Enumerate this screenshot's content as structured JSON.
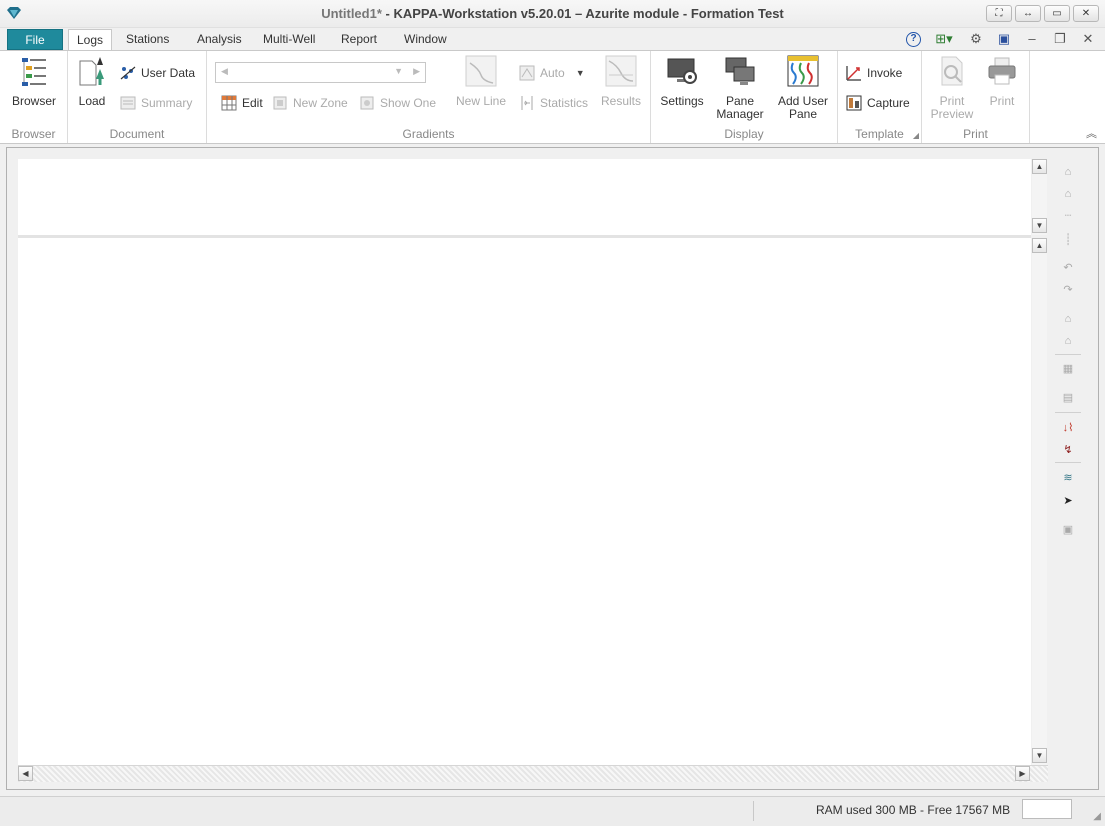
{
  "titlebar": {
    "doc_name": "Untitled1*",
    "title_rest": " - KAPPA-Workstation v5.20.01  – Azurite module - Formation Test"
  },
  "tabs": {
    "file": "File",
    "logs": "Logs",
    "stations": "Stations",
    "analysis": "Analysis",
    "multiwell": "Multi-Well",
    "report": "Report",
    "window": "Window"
  },
  "ribbon": {
    "browser": {
      "button": "Browser",
      "group": "Browser"
    },
    "document": {
      "load": "Load",
      "user_data": "User Data",
      "summary": "Summary",
      "group": "Document"
    },
    "gradients": {
      "edit": "Edit",
      "new_zone": "New Zone",
      "show_one": "Show One",
      "new_line": "New Line",
      "auto": "Auto",
      "statistics": "Statistics",
      "results": "Results",
      "group": "Gradients"
    },
    "display": {
      "settings": "Settings",
      "pane_manager_1": "Pane",
      "pane_manager_2": "Manager",
      "add_user_pane_1": "Add User",
      "add_user_pane_2": "Pane",
      "group": "Display"
    },
    "template": {
      "invoke": "Invoke",
      "capture": "Capture",
      "group": "Template"
    },
    "print": {
      "print_preview_1": "Print",
      "print_preview_2": "Preview",
      "print": "Print",
      "group": "Print"
    }
  },
  "status": {
    "ram": "RAM used 300 MB - Free 17567 MB"
  },
  "colors": {
    "file_tab": "#1f8a9c",
    "accent_red": "#c0392b"
  }
}
